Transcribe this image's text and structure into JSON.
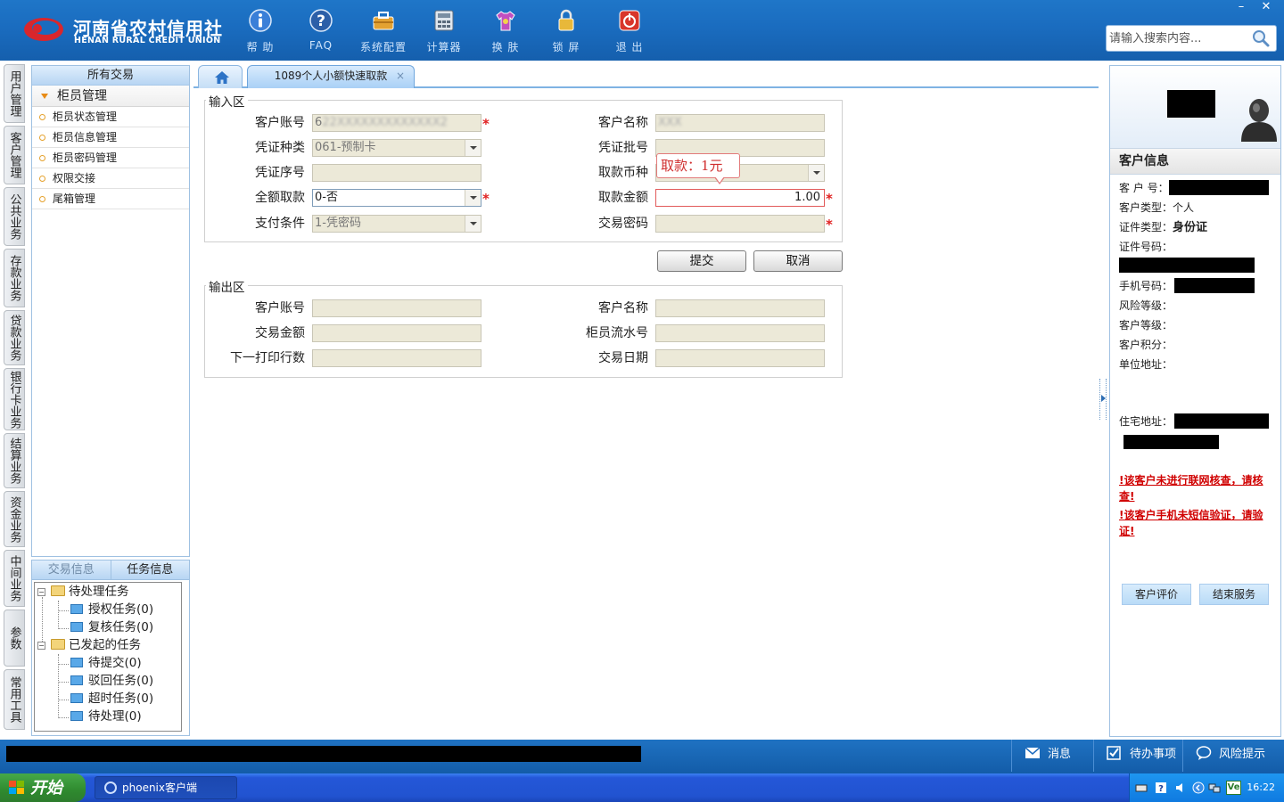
{
  "header": {
    "logo_cn": "河南省农村信用社",
    "logo_en": "HENAN RURAL CREDIT UNION",
    "toolbar": [
      {
        "label": "帮 助",
        "icon": "info-icon"
      },
      {
        "label": "FAQ",
        "icon": "question-icon"
      },
      {
        "label": "系统配置",
        "icon": "toolbox-icon"
      },
      {
        "label": "计算器",
        "icon": "calculator-icon"
      },
      {
        "label": "换 肤",
        "icon": "shirt-icon"
      },
      {
        "label": "锁 屏",
        "icon": "lock-icon"
      },
      {
        "label": "退 出",
        "icon": "power-icon"
      }
    ],
    "search_placeholder": "请输入搜索内容...",
    "window_min": "–",
    "window_close": "✕"
  },
  "vnav": [
    "用户管理",
    "客户管理",
    "公共业务",
    "存款业务",
    "贷款业务",
    "银行卡业务",
    "结算业务",
    "资金业务",
    "中间业务",
    "参数",
    "常用工具"
  ],
  "left_panel": {
    "title": "所有交易",
    "group": "柜员管理",
    "items": [
      "柜员状态管理",
      "柜员信息管理",
      "柜员密码管理",
      "权限交接",
      "尾箱管理"
    ]
  },
  "task_panel": {
    "tab_inactive": "交易信息",
    "tab_active": "任务信息",
    "tree": {
      "pending": "待处理任务",
      "auth": "授权任务(0)",
      "review": "复核任务(0)",
      "initiated": "已发起的任务",
      "to_submit": "待提交(0)",
      "rejected": "驳回任务(0)",
      "timeout": "超时任务(0)",
      "to_process": "待处理(0)"
    }
  },
  "tabs": {
    "active": "1089个人小额快速取款",
    "close": "×"
  },
  "input_area": {
    "legend": "输入区",
    "account_label": "客户账号",
    "account_prefix": "6",
    "account_masked": "22XXXXXXXXXXXXX2",
    "name_label": "客户名称",
    "name_masked": "XXX",
    "voucher_type_label": "凭证种类",
    "voucher_type_value": "061-预制卡",
    "voucher_batch_label": "凭证批号",
    "voucher_seq_label": "凭证序号",
    "currency_label": "取款币种",
    "full_withdraw_label": "全额取款",
    "full_withdraw_value": "0-否",
    "amount_label": "取款金额",
    "amount_value": "1.00",
    "pay_cond_label": "支付条件",
    "pay_cond_value": "1-凭密码",
    "password_label": "交易密码",
    "tooltip": "取款：1元",
    "required_mark": "*"
  },
  "buttons": {
    "submit": "提交",
    "cancel": "取消"
  },
  "output_area": {
    "legend": "输出区",
    "account_label": "客户账号",
    "name_label": "客户名称",
    "amount_label": "交易金额",
    "teller_serial_label": "柜员流水号",
    "next_print_label": "下一打印行数",
    "date_label": "交易日期"
  },
  "customer_info": {
    "title": "客户信息",
    "customer_no_label": "客 户 号：",
    "customer_type_label": "客户类型：",
    "customer_type_value": "个人",
    "id_type_label": "证件类型：",
    "id_type_value": "身份证",
    "id_no_label": "证件号码：",
    "phone_label": "手机号码：",
    "risk_label": "风险等级：",
    "level_label": "客户等级：",
    "points_label": "客户积分：",
    "work_addr_label": "单位地址：",
    "home_addr_label": "住宅地址：",
    "warning1": "该客户未进行联网核查，请核查!",
    "warning2": "该客户手机未短信验证，请验证!",
    "warn_mark": "!",
    "eval_button": "客户评价",
    "end_button": "结束服务"
  },
  "statusbar": {
    "message": "消息",
    "todo": "待办事项",
    "risk": "风险提示"
  },
  "taskbar": {
    "start": "开始",
    "app": "phoenix客户端",
    "clock": "16:22",
    "tray_ve": "Ve"
  }
}
